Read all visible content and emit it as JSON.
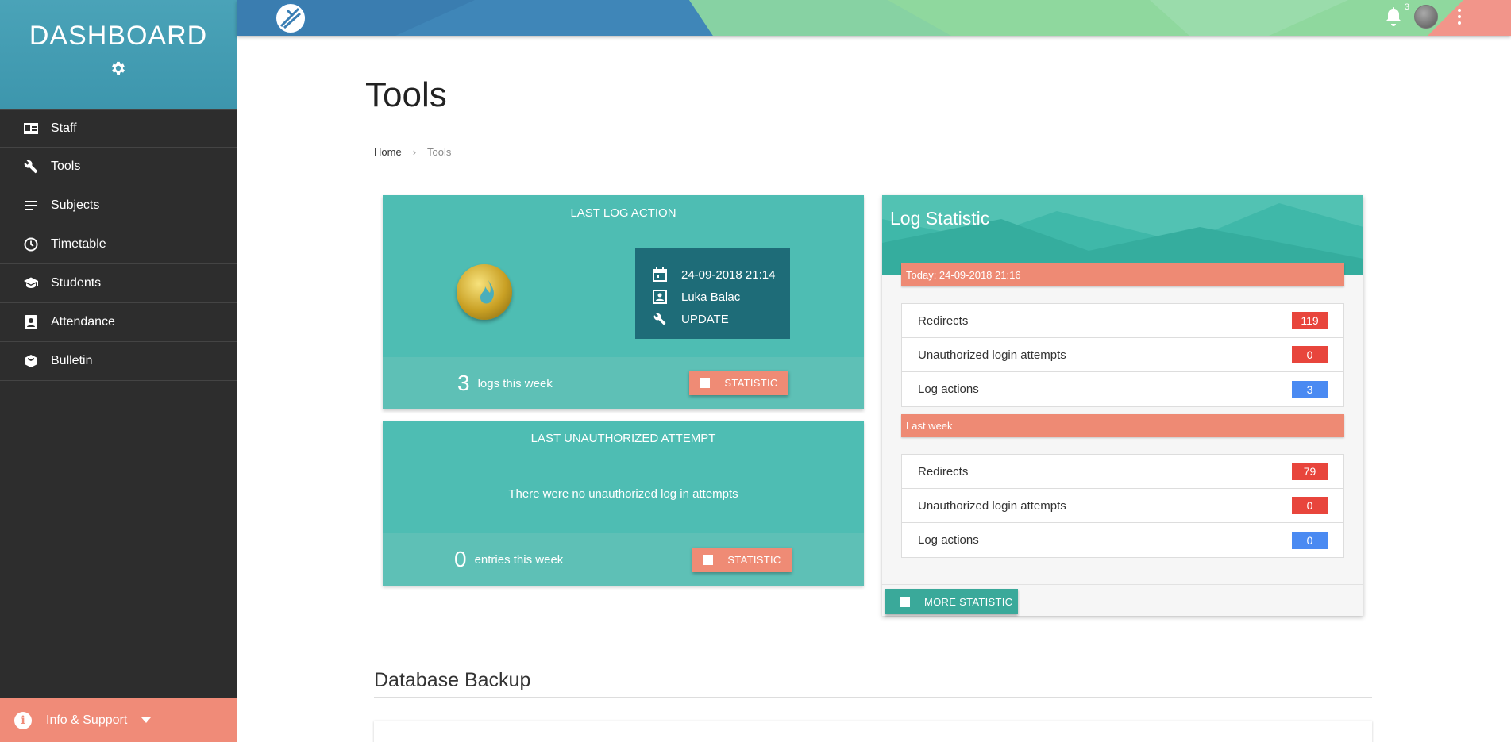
{
  "sidebar": {
    "title": "DASHBOARD",
    "items": [
      {
        "label": "Staff",
        "icon": "id-card-icon"
      },
      {
        "label": "Tools",
        "icon": "wrench-icon"
      },
      {
        "label": "Subjects",
        "icon": "list-icon"
      },
      {
        "label": "Timetable",
        "icon": "clock-icon"
      },
      {
        "label": "Students",
        "icon": "graduation-cap-icon"
      },
      {
        "label": "Attendance",
        "icon": "contact-card-icon"
      },
      {
        "label": "Bulletin",
        "icon": "bulletin-icon"
      }
    ],
    "footer_label": "Info & Support",
    "colors": {
      "header": "#4aa3b8",
      "body": "#2d2d2d",
      "footer": "#f08b78"
    }
  },
  "topbar": {
    "notification_count": "3"
  },
  "page": {
    "title": "Tools",
    "breadcrumb": {
      "home": "Home",
      "current": "Tools"
    }
  },
  "last_log": {
    "title": "LAST LOG ACTION",
    "date": "24-09-2018 21:14",
    "user": "Luka Balac",
    "action": "UPDATE",
    "count": "3",
    "count_label": "logs this week",
    "button": "STATISTIC"
  },
  "last_unauth": {
    "title": "LAST UNAUTHORIZED ATTEMPT",
    "message": "There were no unauthorized log in attempts",
    "count": "0",
    "count_label": "entries this week",
    "button": "STATISTIC"
  },
  "log_statistic": {
    "title": "Log Statistic",
    "today_label": "Today: 24-09-2018 21:16",
    "today": [
      {
        "label": "Redirects",
        "value": "119",
        "color": "red"
      },
      {
        "label": "Unauthorized login attempts",
        "value": "0",
        "color": "red"
      },
      {
        "label": "Log actions",
        "value": "3",
        "color": "blue"
      }
    ],
    "week_label": "Last week",
    "week": [
      {
        "label": "Redirects",
        "value": "79",
        "color": "red"
      },
      {
        "label": "Unauthorized login attempts",
        "value": "0",
        "color": "red"
      },
      {
        "label": "Log actions",
        "value": "0",
        "color": "blue"
      }
    ],
    "more_button": "MORE STATISTIC"
  },
  "database_backup": {
    "title": "Database Backup"
  }
}
